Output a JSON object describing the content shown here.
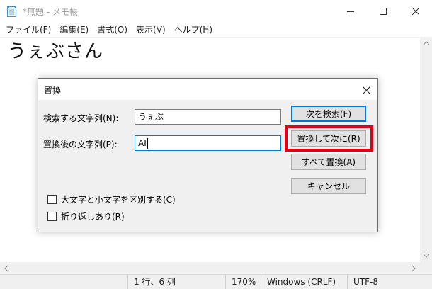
{
  "window": {
    "title": "*無題 - メモ帳"
  },
  "menu": {
    "items": [
      "ファイル(F)",
      "編集(E)",
      "書式(O)",
      "表示(V)",
      "ヘルプ(H)"
    ]
  },
  "editor": {
    "content": "うぇぶさん"
  },
  "status": {
    "position": "1 行、6 列",
    "zoom": "170%",
    "line_ending": "Windows (CRLF)",
    "encoding": "UTF-8"
  },
  "dialog": {
    "title": "置換",
    "find_label": "検索する文字列(N):",
    "find_value": "うぇぶ",
    "replace_label": "置換後の文字列(P):",
    "replace_value": "AI",
    "find_next_button": "次を検索(F)",
    "replace_next_button": "置換して次に(R)",
    "replace_all_button": "すべて置換(A)",
    "cancel_button": "キャンセル",
    "match_case_label": "大文字と小文字を区別する(C)",
    "wrap_around_label": "折り返しあり(R)",
    "match_case_checked": false,
    "wrap_around_checked": false
  },
  "colors": {
    "highlight": "#e00016",
    "focus_blue": "#0078d7"
  }
}
